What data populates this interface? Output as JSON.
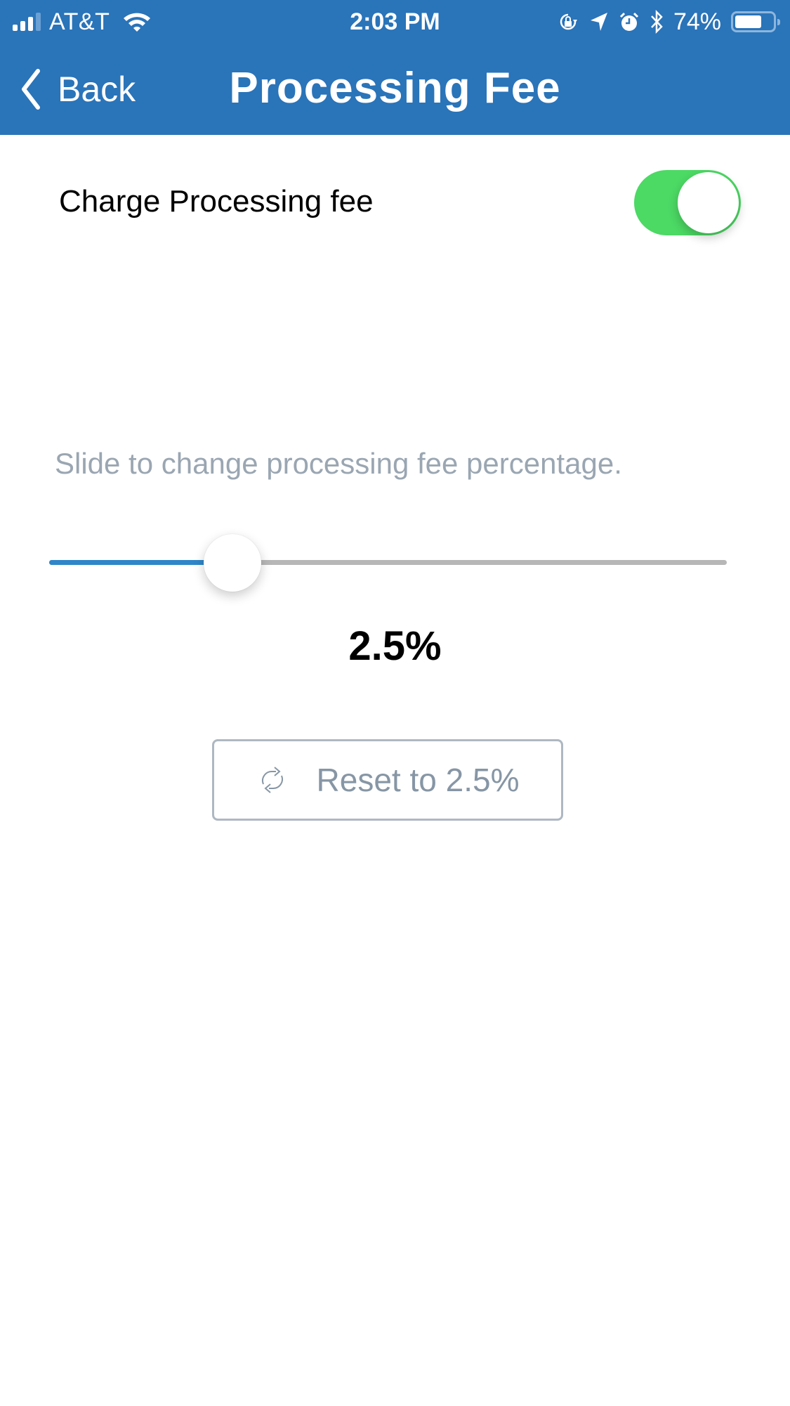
{
  "status_bar": {
    "carrier": "AT&T",
    "time": "2:03 PM",
    "battery_percent_label": "74%",
    "battery_level": 0.74,
    "signal_bars_active": 3,
    "signal_bars_total": 4,
    "icons": [
      "signal-icon",
      "wifi-icon",
      "rotation-lock-icon",
      "location-icon",
      "alarm-icon",
      "bluetooth-icon",
      "battery-icon"
    ]
  },
  "nav": {
    "back_label": "Back",
    "title": "Processing Fee"
  },
  "settings": {
    "charge_fee_label": "Charge Processing fee",
    "charge_fee_enabled": true,
    "toggle_color": "#4cd964"
  },
  "slider": {
    "helper_text": "Slide to change processing fee percentage.",
    "fraction": 0.27,
    "value_label": "2.5%",
    "fill_color": "#2f86c8"
  },
  "reset": {
    "label": "Reset to 2.5%",
    "icon": "refresh-icon"
  },
  "colors": {
    "header_bg": "#2a74b9",
    "muted_text": "#9aa6b2"
  }
}
